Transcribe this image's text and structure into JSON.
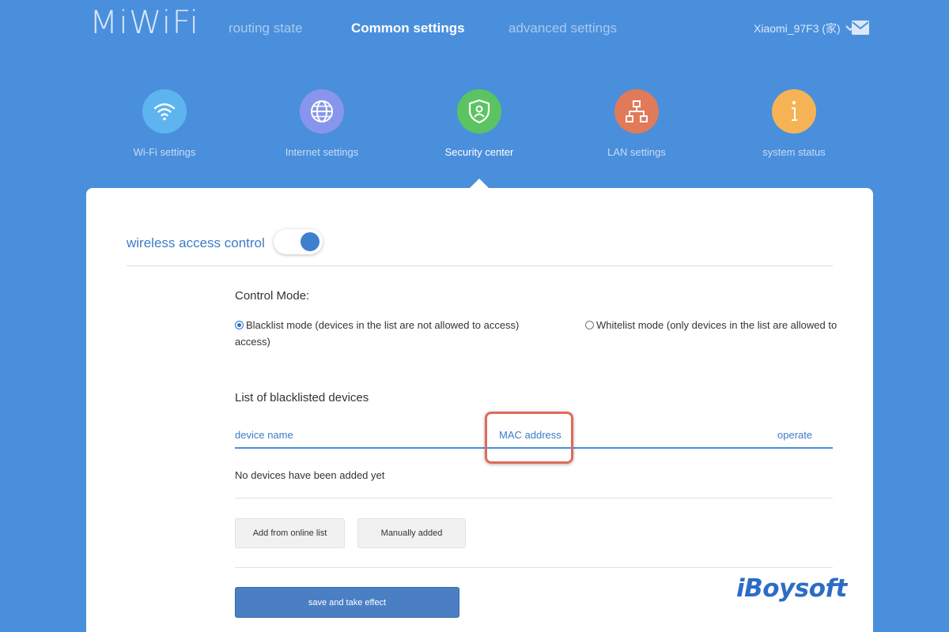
{
  "header": {
    "logo": "MiWiFi",
    "nav": [
      {
        "label": "routing state"
      },
      {
        "label": "Common settings",
        "active": true
      },
      {
        "label": "advanced settings"
      }
    ],
    "user_name": "Xiaomi_97F3 (家)"
  },
  "categories": [
    {
      "label": "Wi-Fi settings",
      "icon": "wifi-icon",
      "color": "#5db4ef"
    },
    {
      "label": "Internet settings",
      "icon": "globe-icon",
      "color": "#8796ec"
    },
    {
      "label": "Security center",
      "icon": "shield-icon",
      "color": "#5cc361",
      "active": true
    },
    {
      "label": "LAN settings",
      "icon": "network-icon",
      "color": "#e17a58"
    },
    {
      "label": "system status",
      "icon": "info-icon",
      "color": "#f6b355"
    }
  ],
  "panel": {
    "wireless_access_control": "wireless access control",
    "toggle_on": true,
    "control_mode_label": "Control Mode:",
    "blacklist_mode_line1": "Blacklist mode (devices in the list are not allowed to access)",
    "blacklist_mode_line2": "access)",
    "whitelist_mode": "Whitelist mode (only devices in the list are allowed to",
    "selected_mode": "blacklist",
    "list_title": "List of blacklisted devices",
    "columns": [
      "device name",
      "MAC address",
      "operate"
    ],
    "empty_message": "No devices have been added yet",
    "add_online_button": "Add from online list",
    "manual_add_button": "Manually added",
    "save_button": "save and take effect"
  },
  "watermark": "iBoysoft",
  "colors": {
    "background": "#4a8fdc",
    "accent": "#3e7cc6",
    "highlight": "#e06a5a"
  }
}
